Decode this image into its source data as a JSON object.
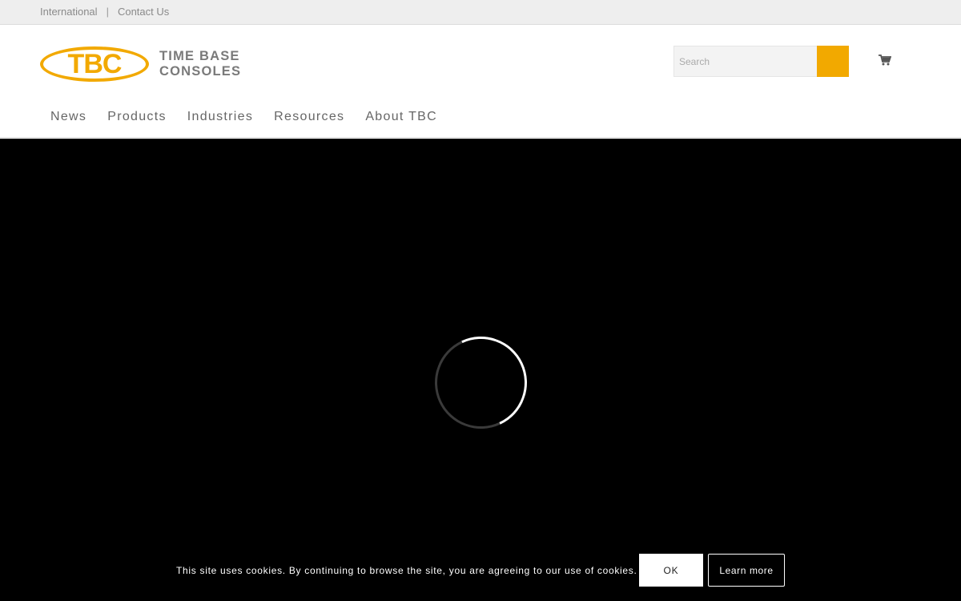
{
  "topbar": {
    "links": [
      {
        "label": "International"
      },
      {
        "label": "Contact Us"
      }
    ],
    "separator": "|"
  },
  "logo": {
    "letters": "TBC",
    "line1": "TIME BASE",
    "line2": "CONSOLES"
  },
  "search": {
    "placeholder": "Search",
    "value": ""
  },
  "nav": {
    "items": [
      {
        "label": "News"
      },
      {
        "label": "Products"
      },
      {
        "label": "Industries"
      },
      {
        "label": "Resources"
      },
      {
        "label": "About TBC"
      }
    ]
  },
  "cookie": {
    "text": "This site uses cookies. By continuing to browse the site, you are agreeing to our use of cookies.",
    "ok_label": "OK",
    "learn_more_label": "Learn more"
  },
  "colors": {
    "brand": "#f2a900",
    "hero_background": "#000000"
  },
  "icons": {
    "search_button": "search-icon",
    "cart": "cart-icon",
    "loading": "loading-spinner"
  }
}
